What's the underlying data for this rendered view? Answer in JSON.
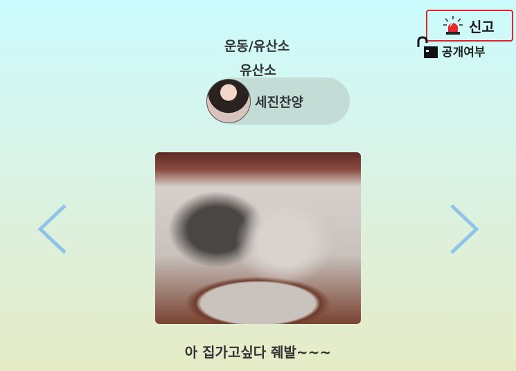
{
  "report": {
    "label": "신고",
    "icon": "siren-icon",
    "highlight_color": "#e0202a"
  },
  "visibility": {
    "label": "공개여부",
    "icon": "unlock-icon"
  },
  "post": {
    "category": "운동/유산소",
    "subcategory": "유산소",
    "author": {
      "name": "세진찬양"
    },
    "image": {
      "description_icon": "kitten-photo"
    },
    "caption": "아 집가고싶다 줴발~~~"
  },
  "nav": {
    "prev_icon": "chevron-left-icon",
    "next_icon": "chevron-right-icon",
    "arrow_color": "#8ec4e8"
  }
}
